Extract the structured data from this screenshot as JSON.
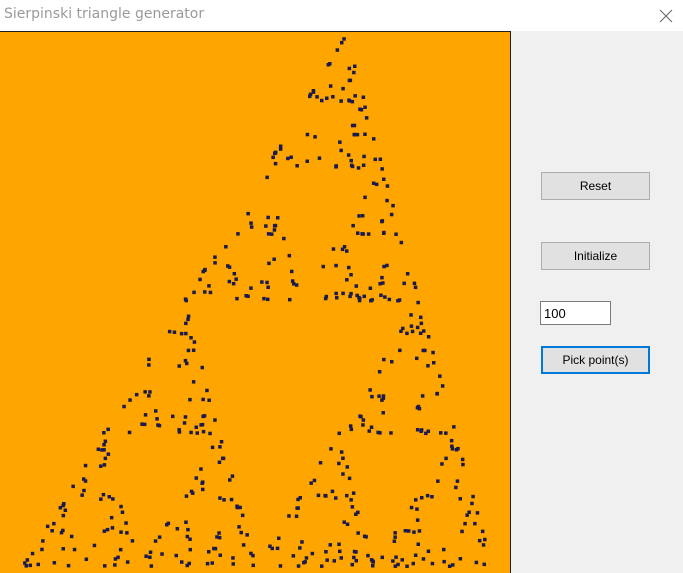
{
  "window": {
    "title": "Sierpinski triangle generator",
    "close_icon": "close-icon"
  },
  "controls": {
    "reset_label": "Reset",
    "initialize_label": "Initialize",
    "count_value": "100",
    "pick_label": "Pick point(s)"
  },
  "canvas": {
    "background_color": "#ffa500",
    "point_color": "#1a1a50"
  }
}
